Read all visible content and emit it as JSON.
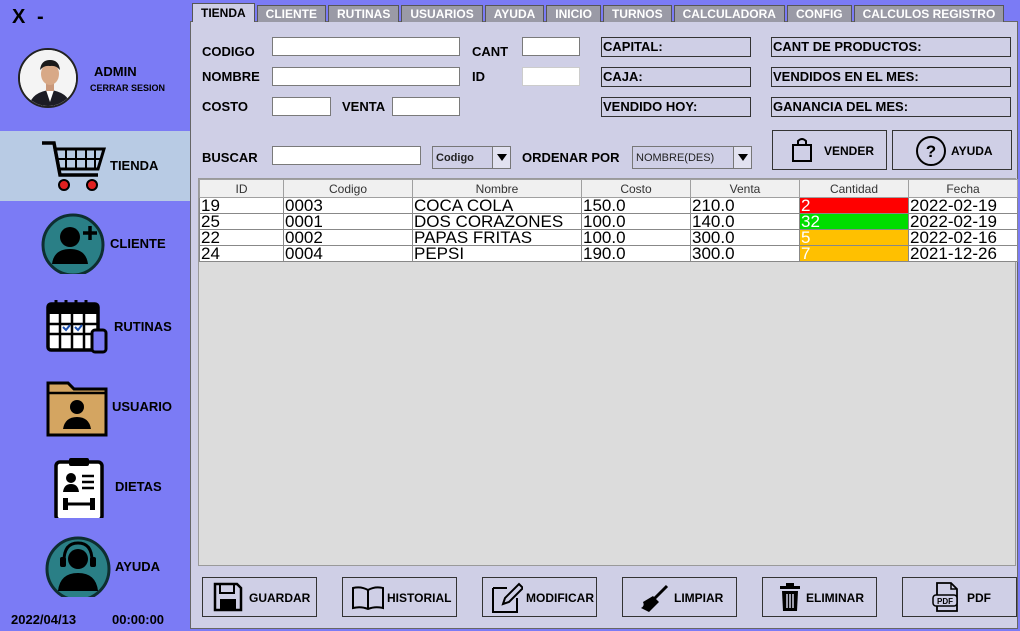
{
  "window": {
    "close": "X",
    "minimize": "-"
  },
  "sidebar": {
    "user_name": "ADMIN",
    "logout": "CERRAR SESION",
    "items": [
      {
        "label": "TIENDA",
        "icon": "shopping-cart-icon",
        "active": true
      },
      {
        "label": "CLIENTE",
        "icon": "add-user-icon"
      },
      {
        "label": "RUTINAS",
        "icon": "calendar-icon"
      },
      {
        "label": "USUARIO",
        "icon": "user-folder-icon"
      },
      {
        "label": "DIETAS",
        "icon": "clipboard-dumbbell-icon"
      },
      {
        "label": "AYUDA",
        "icon": "headset-icon"
      }
    ],
    "date": "2022/04/13",
    "time": "00:00:00"
  },
  "tabs": [
    "TIENDA",
    "CLIENTE",
    "RUTINAS",
    "USUARIOS",
    "AYUDA",
    "INICIO",
    "TURNOS",
    "CALCULADORA",
    "CONFIG",
    "CALCULOS REGISTRO"
  ],
  "form": {
    "codigo_label": "CODIGO",
    "nombre_label": "NOMBRE",
    "costo_label": "COSTO",
    "venta_label": "VENTA",
    "cant_label": "CANT",
    "id_label": "ID",
    "buscar_label": "BUSCAR",
    "search_by": "Codigo",
    "ordenar_label": "ORDENAR POR",
    "order_by": "NOMBRE(DES)"
  },
  "stats": {
    "capital": "CAPITAL:",
    "caja": "CAJA:",
    "vendido_hoy": "VENDIDO HOY:",
    "cant_productos": "CANT DE PRODUCTOS:",
    "vendidos_mes": "VENDIDOS EN EL MES:",
    "ganancia_mes": "GANANCIA DEL MES:"
  },
  "actions": {
    "vender": "VENDER",
    "ayuda": "AYUDA"
  },
  "table": {
    "columns": [
      "ID",
      "Codigo",
      "Nombre",
      "Costo",
      "Venta",
      "Cantidad",
      "Fecha"
    ],
    "rows": [
      [
        "19",
        "0003",
        "COCA COLA",
        "150.0",
        "210.0",
        "2",
        "2022-02-19"
      ],
      [
        "25",
        "0001",
        "DOS CORAZONES",
        "100.0",
        "140.0",
        "32",
        "2022-02-19"
      ],
      [
        "22",
        "0002",
        "PAPAS FRITAS",
        "100.0",
        "300.0",
        "5",
        "2022-02-16"
      ],
      [
        "24",
        "0004",
        "PEPSI",
        "190.0",
        "300.0",
        "7",
        "2021-12-26"
      ]
    ],
    "quantity_colors": [
      "#ff0000",
      "#00dd00",
      "#ffc000",
      "#ffc000"
    ]
  },
  "bottom_buttons": [
    "GUARDAR",
    "HISTORIAL",
    "MODIFICAR",
    "LIMPIAR",
    "ELIMINAR",
    "PDF"
  ],
  "colors": {
    "background": "#7b7bf5",
    "panel": "#cfcfe6",
    "active_nav": "#b8cbe4"
  }
}
